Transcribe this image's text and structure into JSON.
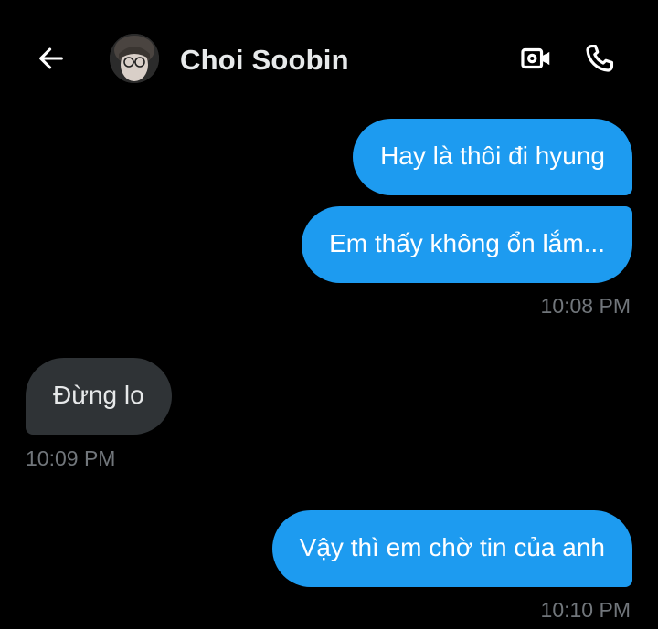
{
  "header": {
    "contact_name": "Choi Soobin",
    "icons": [
      "back-arrow-icon",
      "avatar",
      "video-camera-icon",
      "phone-icon"
    ]
  },
  "messages": [
    {
      "direction": "outgoing",
      "text": "Hay là thôi đi hyung"
    },
    {
      "direction": "outgoing",
      "text": "Em thấy không ổn lắm..."
    },
    {
      "direction": "incoming",
      "text": "Đừng lo"
    },
    {
      "direction": "outgoing",
      "text": "Vậy thì em chờ tin của anh"
    }
  ],
  "timestamps": {
    "t1": "10:08 PM",
    "t2": "10:09 PM",
    "t3": "10:10 PM"
  },
  "colors": {
    "background": "#000000",
    "outgoing_bubble": "#1d9bf0",
    "incoming_bubble": "#2f3336",
    "timestamp": "#71767b",
    "text": "#e7e9ea"
  }
}
